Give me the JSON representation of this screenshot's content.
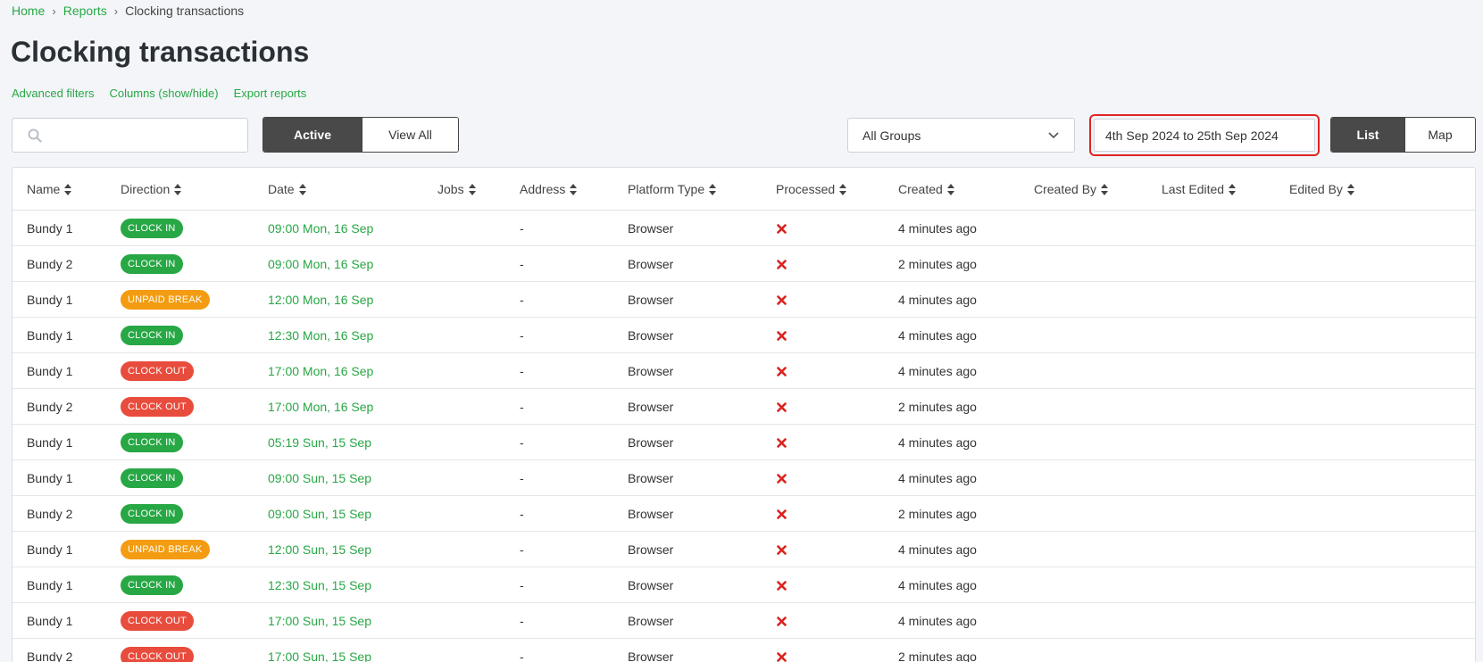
{
  "breadcrumb": {
    "home": "Home",
    "reports": "Reports",
    "current": "Clocking transactions",
    "separator": "›"
  },
  "page": {
    "title": "Clocking transactions"
  },
  "links": {
    "advanced_filters": "Advanced filters",
    "columns": "Columns (show/hide)",
    "export": "Export reports"
  },
  "search": {
    "placeholder": "",
    "value": "",
    "icon": "search-icon"
  },
  "status_toggle": {
    "active": "Active",
    "view_all": "View All",
    "selected": "Active"
  },
  "groups_select": {
    "value": "All Groups",
    "icon": "chevron-down-icon"
  },
  "date_range": {
    "value": "4th Sep 2024 to 25th Sep 2024"
  },
  "view_toggle": {
    "list": "List",
    "map": "Map",
    "selected": "List"
  },
  "colors": {
    "accent": "#28a745",
    "clock_in": "#28a745",
    "clock_out": "#e84c3d",
    "unpaid_break": "#f39c12",
    "not_processed": "#d9231f",
    "highlight": "#e02424"
  },
  "table": {
    "columns": [
      "Name",
      "Direction",
      "Date",
      "Jobs",
      "Address",
      "Platform Type",
      "Processed",
      "Created",
      "Created By",
      "Last Edited",
      "Edited By"
    ],
    "rows": [
      {
        "name": "Bundy 1",
        "direction": "CLOCK IN",
        "type": "in",
        "date": "09:00 Mon, 16 Sep",
        "address": "-",
        "platform": "Browser",
        "processed": false,
        "created": "4 minutes ago"
      },
      {
        "name": "Bundy 2",
        "direction": "CLOCK IN",
        "type": "in",
        "date": "09:00 Mon, 16 Sep",
        "address": "-",
        "platform": "Browser",
        "processed": false,
        "created": "2 minutes ago"
      },
      {
        "name": "Bundy 1",
        "direction": "UNPAID BREAK",
        "type": "break",
        "date": "12:00 Mon, 16 Sep",
        "address": "-",
        "platform": "Browser",
        "processed": false,
        "created": "4 minutes ago"
      },
      {
        "name": "Bundy 1",
        "direction": "CLOCK IN",
        "type": "in",
        "date": "12:30 Mon, 16 Sep",
        "address": "-",
        "platform": "Browser",
        "processed": false,
        "created": "4 minutes ago"
      },
      {
        "name": "Bundy 1",
        "direction": "CLOCK OUT",
        "type": "out",
        "date": "17:00 Mon, 16 Sep",
        "address": "-",
        "platform": "Browser",
        "processed": false,
        "created": "4 minutes ago"
      },
      {
        "name": "Bundy 2",
        "direction": "CLOCK OUT",
        "type": "out",
        "date": "17:00 Mon, 16 Sep",
        "address": "-",
        "platform": "Browser",
        "processed": false,
        "created": "2 minutes ago"
      },
      {
        "name": "Bundy 1",
        "direction": "CLOCK IN",
        "type": "in",
        "date": "05:19 Sun, 15 Sep",
        "address": "-",
        "platform": "Browser",
        "processed": false,
        "created": "4 minutes ago"
      },
      {
        "name": "Bundy 1",
        "direction": "CLOCK IN",
        "type": "in",
        "date": "09:00 Sun, 15 Sep",
        "address": "-",
        "platform": "Browser",
        "processed": false,
        "created": "4 minutes ago"
      },
      {
        "name": "Bundy 2",
        "direction": "CLOCK IN",
        "type": "in",
        "date": "09:00 Sun, 15 Sep",
        "address": "-",
        "platform": "Browser",
        "processed": false,
        "created": "2 minutes ago"
      },
      {
        "name": "Bundy 1",
        "direction": "UNPAID BREAK",
        "type": "break",
        "date": "12:00 Sun, 15 Sep",
        "address": "-",
        "platform": "Browser",
        "processed": false,
        "created": "4 minutes ago"
      },
      {
        "name": "Bundy 1",
        "direction": "CLOCK IN",
        "type": "in",
        "date": "12:30 Sun, 15 Sep",
        "address": "-",
        "platform": "Browser",
        "processed": false,
        "created": "4 minutes ago"
      },
      {
        "name": "Bundy 1",
        "direction": "CLOCK OUT",
        "type": "out",
        "date": "17:00 Sun, 15 Sep",
        "address": "-",
        "platform": "Browser",
        "processed": false,
        "created": "4 minutes ago"
      },
      {
        "name": "Bundy 2",
        "direction": "CLOCK OUT",
        "type": "out",
        "date": "17:00 Sun, 15 Sep",
        "address": "-",
        "platform": "Browser",
        "processed": false,
        "created": "2 minutes ago"
      }
    ]
  }
}
